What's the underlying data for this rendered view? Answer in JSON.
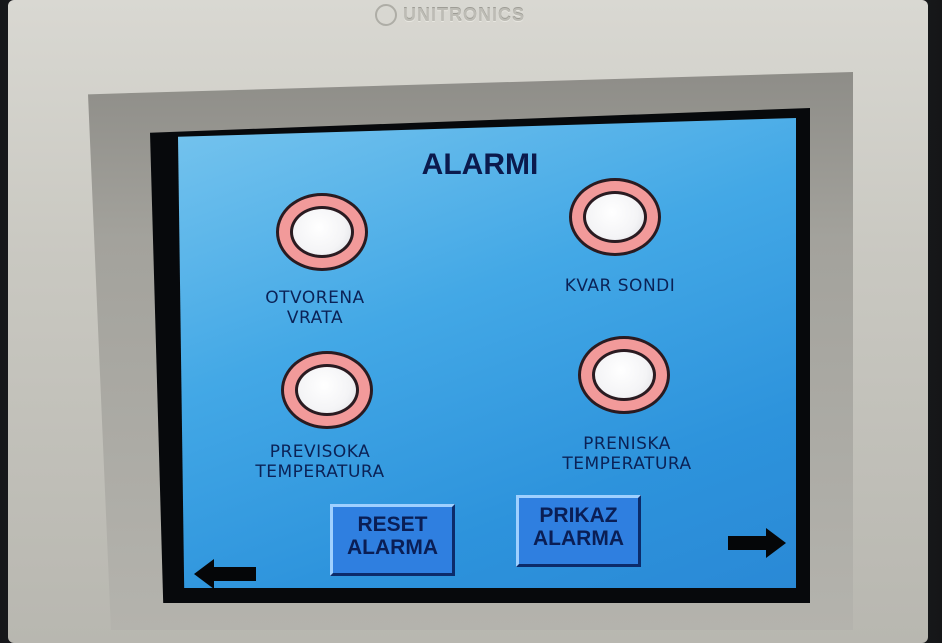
{
  "device": {
    "brand": "UNITRONICS"
  },
  "screen": {
    "title": "ALARMI",
    "alarms": [
      {
        "label_line1": "OTVORENA",
        "label_line2": "VRATA"
      },
      {
        "label_line1": "KVAR SONDI",
        "label_line2": ""
      },
      {
        "label_line1": "PREVISOKA",
        "label_line2": "TEMPERATURA"
      },
      {
        "label_line1": "PRENISKA",
        "label_line2": "TEMPERATURA"
      }
    ],
    "buttons": {
      "reset": {
        "line1": "RESET",
        "line2": "ALARMA"
      },
      "show": {
        "line1": "PRIKAZ",
        "line2": "ALARMA"
      }
    },
    "nav": {
      "back": "arrow-left-icon",
      "next": "arrow-right-icon"
    }
  },
  "colors": {
    "screen_bg": "#43a8e6",
    "lamp_ring": "#f29a9a",
    "lamp_core": "#ffffff",
    "text": "#0b1a4d",
    "button_bg": "#2f7fe0"
  }
}
